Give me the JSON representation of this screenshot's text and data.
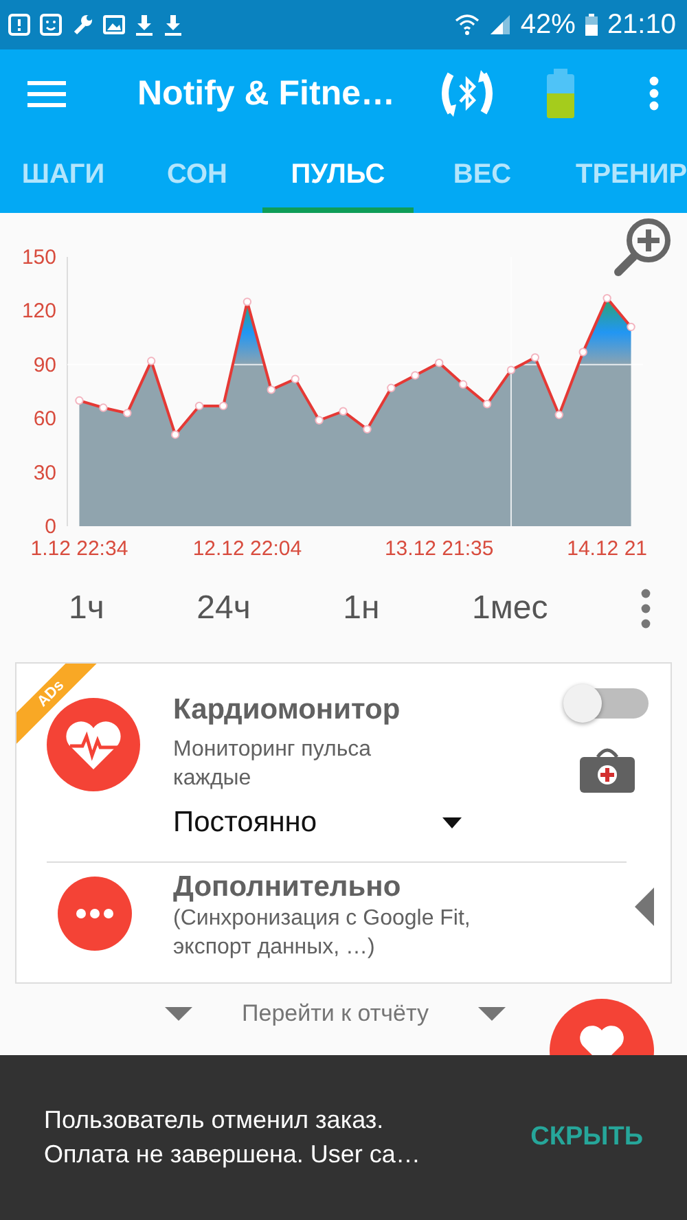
{
  "status_bar": {
    "battery": "42%",
    "time": "21:10"
  },
  "app_bar": {
    "title": "Notify & Fitne…"
  },
  "tabs": [
    {
      "label": "ШАГИ",
      "selected": false
    },
    {
      "label": "СОН",
      "selected": false
    },
    {
      "label": "ПУЛЬС",
      "selected": true
    },
    {
      "label": "ВЕС",
      "selected": false
    },
    {
      "label": "ТРЕНИР",
      "selected": false
    }
  ],
  "chart": {
    "chart_data": {
      "type": "area",
      "categories": [
        "1.12 22:34",
        null,
        null,
        null,
        null,
        null,
        null,
        "12.12 22:04",
        null,
        null,
        null,
        null,
        null,
        null,
        null,
        "13.12 21:35",
        null,
        null,
        null,
        null,
        null,
        null,
        "14.12 21",
        null
      ],
      "series": [
        {
          "color": "#e53935",
          "values": [
            70,
            66,
            63,
            92,
            51,
            67,
            67,
            125,
            76,
            82,
            59,
            64,
            54,
            77,
            84,
            91,
            79,
            68,
            87,
            94,
            62,
            97,
            127,
            111
          ]
        }
      ],
      "ylim": [
        0,
        150
      ],
      "yticks": [
        0,
        30,
        60,
        90,
        120,
        150
      ]
    }
  },
  "ranges": [
    "1ч",
    "24ч",
    "1н",
    "1мес"
  ],
  "card": {
    "badge": "ADs",
    "title": "Кардиомонитор",
    "subtitle": "Мониторинг пульса каждые",
    "on": false,
    "dropdown": "Постоянно",
    "more_title": "Дополнительно",
    "more_subtitle": "(Синхронизация с Google Fit, экспорт данных, …)"
  },
  "report_link": "Перейти к отчёту",
  "snackbar": {
    "message": "Пользователь отменил заказ. Оплата не завершена. User ca…",
    "action": "СКРЫТЬ"
  }
}
